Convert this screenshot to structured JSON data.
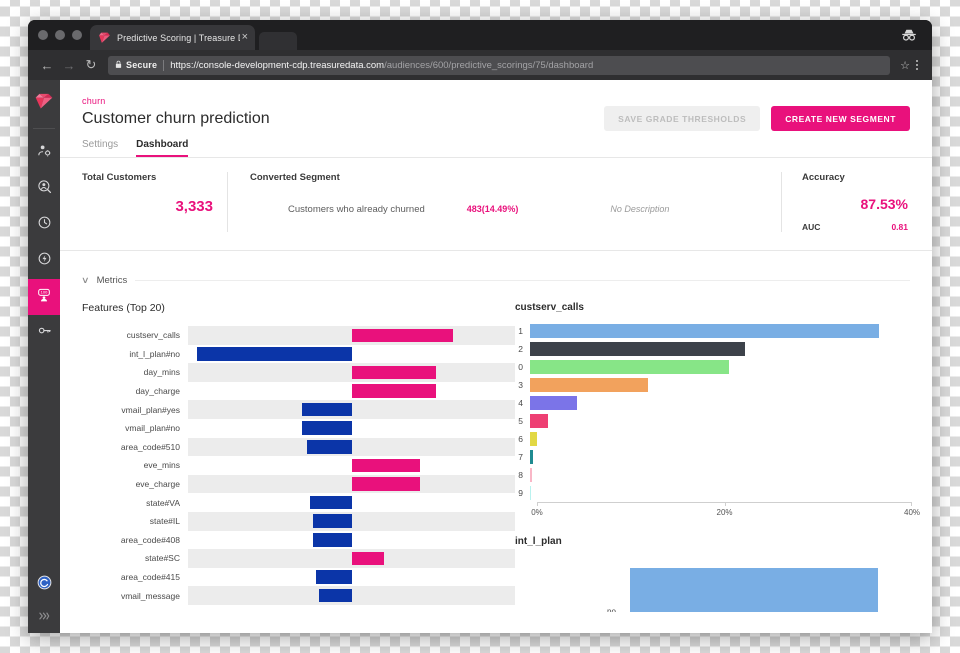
{
  "browser": {
    "tab_title": "Predictive Scoring | Treasure D",
    "tab_close": "×",
    "favicon": "treasure-data-diamond-icon",
    "back": "←",
    "forward": "→",
    "reload": "↻",
    "lock_icon": "lock-icon",
    "secure_label": "Secure",
    "url_host": "https://console-development-cdp.treasuredata.com",
    "url_path": "/audiences/600/predictive_scorings/75/dashboard",
    "star_icon": "☆",
    "menu_icon": "kebab-menu-icon",
    "incognito_icon": "incognito-icon"
  },
  "rail": {
    "logo": "treasure-data-diamond-logo",
    "items": [
      {
        "name": "audience-studio",
        "icon": "person-gear-icon",
        "active": false
      },
      {
        "name": "profiles",
        "icon": "person-search-icon",
        "active": false
      },
      {
        "name": "activations",
        "icon": "clock-icon",
        "active": false
      },
      {
        "name": "journeys",
        "icon": "bolt-circle-icon",
        "active": false
      },
      {
        "name": "predictive-scoring",
        "icon": "score-badge-icon",
        "active": true
      },
      {
        "name": "permissions",
        "icon": "key-icon",
        "active": false
      }
    ],
    "bottom": [
      {
        "name": "account-avatar",
        "icon": "avatar-swirl-icon"
      },
      {
        "name": "expand-rail",
        "icon": "chevron-double-right-icon"
      }
    ]
  },
  "header": {
    "breadcrumb": "churn",
    "title": "Customer churn prediction",
    "tabs": [
      {
        "label": "Settings",
        "selected": false
      },
      {
        "label": "Dashboard",
        "selected": true
      }
    ],
    "save_label": "SAVE GRADE THRESHOLDS",
    "create_label": "CREATE NEW SEGMENT"
  },
  "stats": {
    "total_customers_label": "Total Customers",
    "total_customers_value": "3,333",
    "converted_segment_label": "Converted Segment",
    "converted_name": "Customers who already churned",
    "converted_count": "483",
    "converted_pct": "(14.49%)",
    "no_description": "No Description",
    "accuracy_label": "Accuracy",
    "accuracy_value": "87.53%",
    "auc_label": "AUC",
    "auc_value": "0.81"
  },
  "metrics": {
    "chevron": "∨",
    "label": "Metrics"
  },
  "chart_data": [
    {
      "type": "bar",
      "orientation": "horizontal-diverging",
      "title": "Features (Top 20)",
      "xlabel": "",
      "ylabel": "",
      "grid": false,
      "legend": null,
      "note": "Diverging importance bars; negative (blue) extend left of zero, positive (pink) extend right of zero. Values are signed contribution in arbitrary units, zero axis at 50% of track.",
      "categories": [
        "custserv_calls",
        "int_l_plan#no",
        "day_mins",
        "day_charge",
        "vmail_plan#yes",
        "vmail_plan#no",
        "area_code#510",
        "eve_mins",
        "eve_charge",
        "state#VA",
        "state#IL",
        "area_code#408",
        "state#SC",
        "area_code#415",
        "vmail_message"
      ],
      "values": [
        0.497,
        -0.754,
        0.415,
        0.415,
        -0.244,
        -0.244,
        -0.22,
        0.335,
        0.335,
        -0.205,
        -0.19,
        -0.19,
        0.16,
        -0.173,
        -0.16
      ]
    },
    {
      "type": "bar",
      "orientation": "horizontal",
      "title": "custserv_calls",
      "xlabel": "",
      "ylabel": "",
      "xlim": [
        0,
        40
      ],
      "xticks": [
        "0%",
        "20%",
        "40%"
      ],
      "grid": false,
      "categories": [
        "1",
        "2",
        "0",
        "3",
        "4",
        "5",
        "6",
        "7",
        "8",
        "9"
      ],
      "values": [
        36.5,
        22.5,
        20.8,
        12.4,
        4.9,
        1.9,
        0.75,
        0.3,
        0.18,
        0.07
      ],
      "colors": [
        "#79aee4",
        "#3d424a",
        "#87e587",
        "#f2a25d",
        "#7b74e8",
        "#ee3f73",
        "#e2d844",
        "#1f8b91",
        "#f9b7c7",
        "#b9f2ef"
      ]
    },
    {
      "type": "bar",
      "orientation": "vertical",
      "title": "int_l_plan",
      "xlabel": "",
      "ylabel": "",
      "grid": false,
      "categories": [
        "no"
      ],
      "values": [
        90
      ],
      "colors": [
        "#79aee4"
      ],
      "note": "chart is clipped by the bottom edge of the viewport"
    }
  ]
}
